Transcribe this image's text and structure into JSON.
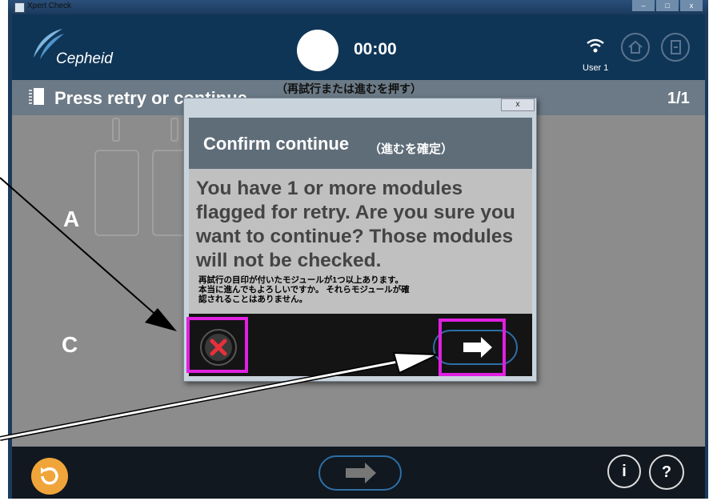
{
  "window": {
    "title": "Xpert Check",
    "controls": [
      "–",
      "□",
      "x"
    ]
  },
  "header": {
    "logo_text": "Cepheid",
    "timer": "00:00",
    "user": "User 1"
  },
  "subheader": {
    "title": "Press retry or continue",
    "page": "1/1",
    "annotation": "（再試行または進むを押す）"
  },
  "main": {
    "rows": [
      "A",
      "C"
    ]
  },
  "dialog": {
    "close_label": "x",
    "title": "Confirm continue",
    "title_annotation": "（進むを確定）",
    "message": "You have 1 or more modules flagged for retry.  Are you sure you want to continue?  Those modules will not be checked.",
    "message_annotation": "再試行の目印が付いたモジュールが1つ以上あります。\n本当に進んでもよろしいですか。 それらモジュールが確\n認されることはありません。"
  },
  "footer": {
    "info_label": "i",
    "help_label": "?"
  },
  "colors": {
    "header_bg": "#0f3556",
    "highlight": "#e020e0",
    "cancel_red": "#e8303a",
    "refresh_orange": "#f0a53a"
  },
  "icons": {
    "dialog_cancel": "x-circle-icon",
    "dialog_next": "arrow-right-icon",
    "footer_next": "arrow-right-icon",
    "refresh": "refresh-icon",
    "wifi": "wifi-icon"
  }
}
